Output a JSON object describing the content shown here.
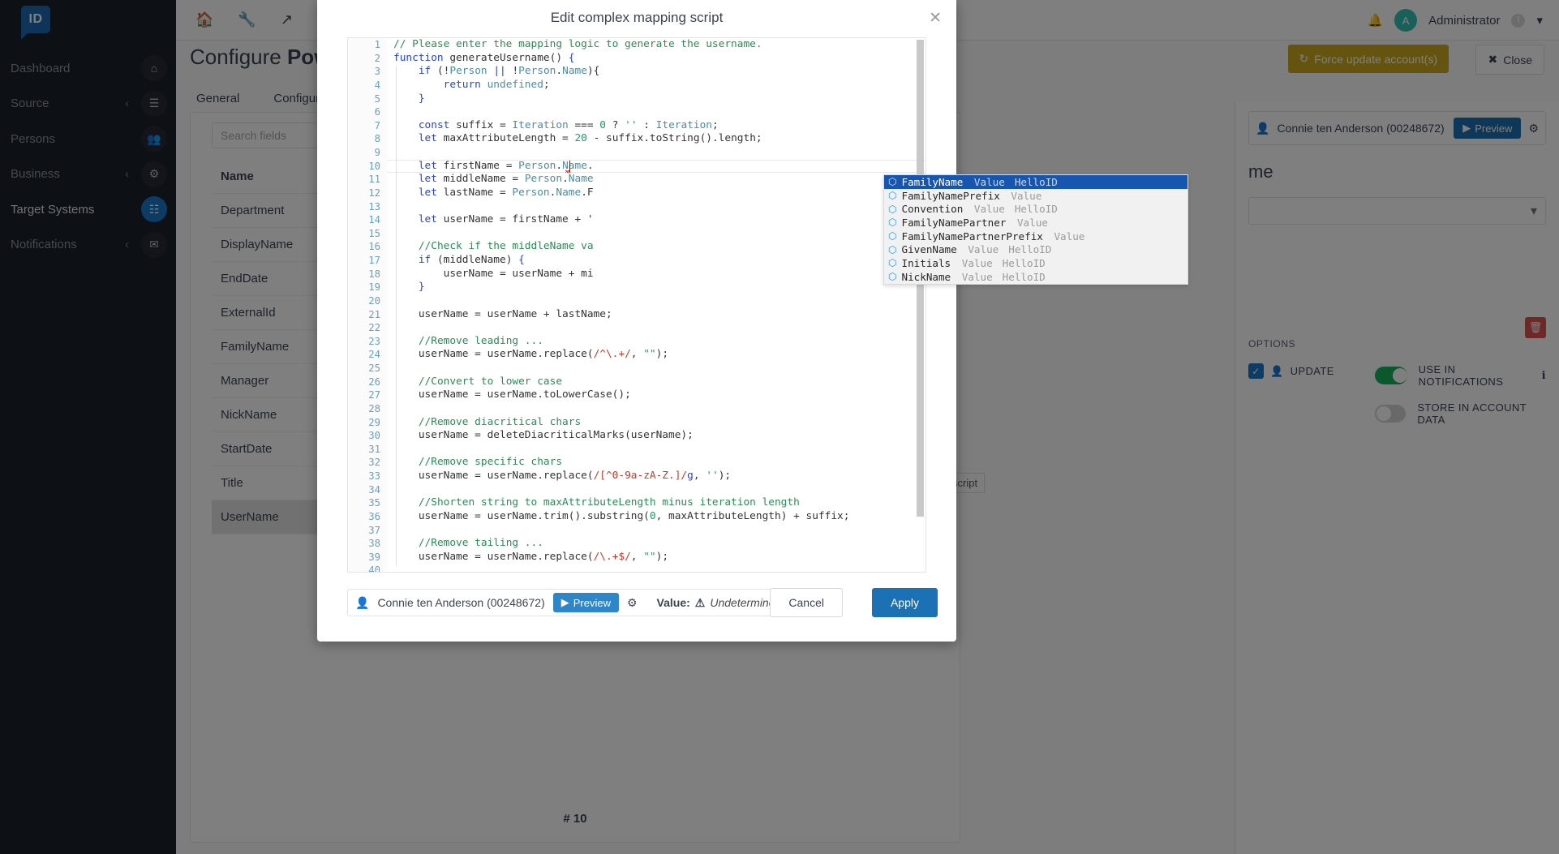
{
  "app": {
    "logo_text": "ID",
    "sidebar": {
      "items": [
        {
          "label": "Dashboard",
          "icon": "home-icon",
          "chevron": false,
          "active": false
        },
        {
          "label": "Source",
          "icon": "layers-icon",
          "chevron": true,
          "active": false
        },
        {
          "label": "Persons",
          "icon": "people-icon",
          "chevron": false,
          "active": false
        },
        {
          "label": "Business",
          "icon": "gear-circle-icon",
          "chevron": true,
          "active": false
        },
        {
          "label": "Target Systems",
          "icon": "grid-icon",
          "chevron": false,
          "active": true
        },
        {
          "label": "Notifications",
          "icon": "mail-icon",
          "chevron": true,
          "active": false
        }
      ]
    },
    "topbar": {
      "icons": [
        "home-icon",
        "wrench-icon",
        "connector-icon",
        "chart-icon",
        "help-icon"
      ],
      "bell": "bell-icon",
      "user_initial": "A",
      "user_name": "Administrator",
      "warning_badge": "!",
      "caret": "▾"
    },
    "page": {
      "title_prefix": "Configure ",
      "title_bold": "PowerSh",
      "force_update_label": "Force update account(s)",
      "force_update_icon": "refresh-icon",
      "close_label": "Close",
      "close_icon": "x-icon",
      "tabs": [
        "General",
        "Configuration"
      ],
      "search_placeholder": "Search fields",
      "table": {
        "header": "Name",
        "rows": [
          "Department",
          "DisplayName",
          "EndDate",
          "ExternalId",
          "FamilyName",
          "Manager",
          "NickName",
          "StartDate",
          "Title",
          "UserName"
        ],
        "selected": "UserName"
      },
      "pager": "# 10",
      "script_tag": "script"
    },
    "right_panel": {
      "person_label": "Connie ten Anderson (00248672)",
      "person_icon": "person-add-icon",
      "preview_label": "Preview",
      "preview_icon": "play-icon",
      "gear_icon": "gear-icon",
      "field_title": "me",
      "options_header": "OPTIONS",
      "update_label": "UPDATE",
      "update_icon": "person-sync-icon",
      "delete_icon": "trash-icon",
      "toggles": [
        {
          "label": "USE IN NOTIFICATIONS",
          "on": true,
          "info": "ℹ"
        },
        {
          "label": "STORE IN ACCOUNT DATA",
          "on": false,
          "info": ""
        }
      ]
    }
  },
  "modal": {
    "title": "Edit complex mapping script",
    "close_icon": "close-icon",
    "cancel_label": "Cancel",
    "apply_label": "Apply",
    "footer": {
      "person_label": "Connie ten Anderson (00248672)",
      "person_icon": "person-add-icon",
      "preview_label": "Preview",
      "preview_icon": "play-icon",
      "gear_icon": "gear-icon",
      "value_label": "Value:",
      "value_warn_icon": "warning-icon",
      "value_text": "Undetermined"
    },
    "editor": {
      "cursor_line": 10,
      "lines": [
        {
          "n": 1,
          "tokens": [
            {
              "t": "// Please enter the mapping logic to generate the username.",
              "c": "tok-com"
            }
          ]
        },
        {
          "n": 2,
          "tokens": [
            {
              "t": "function",
              "c": "tok-kw"
            },
            {
              "t": " generateUsername",
              "c": "tok-fn"
            },
            {
              "t": "() ",
              "c": "tok-str"
            },
            {
              "t": "{",
              "c": "tok-g"
            }
          ]
        },
        {
          "n": 3,
          "tokens": [
            {
              "t": "    ",
              "c": ""
            },
            {
              "t": "if",
              "c": "tok-kw"
            },
            {
              "t": " (!",
              "c": "tok-str"
            },
            {
              "t": "Person",
              "c": "tok-id"
            },
            {
              "t": " || ",
              "c": "tok-g"
            },
            {
              "t": "!",
              "c": "tok-str"
            },
            {
              "t": "Person",
              "c": "tok-id"
            },
            {
              "t": ".",
              "c": "tok-str"
            },
            {
              "t": "Name",
              "c": "tok-id"
            },
            {
              "t": "){",
              "c": "tok-str"
            }
          ]
        },
        {
          "n": 4,
          "tokens": [
            {
              "t": "        ",
              "c": ""
            },
            {
              "t": "return",
              "c": "tok-ret"
            },
            {
              "t": " undefined",
              "c": "tok-id"
            },
            {
              "t": ";",
              "c": "tok-str"
            }
          ]
        },
        {
          "n": 5,
          "tokens": [
            {
              "t": "    ",
              "c": ""
            },
            {
              "t": "}",
              "c": "tok-g"
            }
          ]
        },
        {
          "n": 6,
          "tokens": []
        },
        {
          "n": 7,
          "tokens": [
            {
              "t": "    ",
              "c": ""
            },
            {
              "t": "const",
              "c": "tok-kw"
            },
            {
              "t": " suffix = ",
              "c": "tok-str"
            },
            {
              "t": "Iteration",
              "c": "tok-id"
            },
            {
              "t": " === ",
              "c": "tok-str"
            },
            {
              "t": "0",
              "c": "tok-num"
            },
            {
              "t": " ? ",
              "c": "tok-str"
            },
            {
              "t": "''",
              "c": "tok-num"
            },
            {
              "t": " : ",
              "c": "tok-str"
            },
            {
              "t": "Iteration",
              "c": "tok-id"
            },
            {
              "t": ";",
              "c": "tok-str"
            }
          ]
        },
        {
          "n": 8,
          "tokens": [
            {
              "t": "    ",
              "c": ""
            },
            {
              "t": "let",
              "c": "tok-kw"
            },
            {
              "t": " maxAttributeLength = ",
              "c": "tok-str"
            },
            {
              "t": "20",
              "c": "tok-num"
            },
            {
              "t": " - suffix.",
              "c": "tok-str"
            },
            {
              "t": "toString",
              "c": "tok-str"
            },
            {
              "t": "().length;",
              "c": "tok-str"
            }
          ]
        },
        {
          "n": 9,
          "tokens": []
        },
        {
          "n": 10,
          "tokens": [
            {
              "t": "    ",
              "c": ""
            },
            {
              "t": "let",
              "c": "tok-kw"
            },
            {
              "t": " firstName = ",
              "c": "tok-str"
            },
            {
              "t": "Person",
              "c": "tok-id"
            },
            {
              "t": ".",
              "c": "tok-str"
            },
            {
              "t": "Name",
              "c": "tok-id"
            },
            {
              "t": ".",
              "c": "tok-str"
            }
          ]
        },
        {
          "n": 11,
          "tokens": [
            {
              "t": "    ",
              "c": ""
            },
            {
              "t": "let",
              "c": "tok-kw"
            },
            {
              "t": " middleName = ",
              "c": "tok-str"
            },
            {
              "t": "Person",
              "c": "tok-id"
            },
            {
              "t": ".",
              "c": "tok-str"
            },
            {
              "t": "Name",
              "c": "tok-id"
            }
          ]
        },
        {
          "n": 12,
          "tokens": [
            {
              "t": "    ",
              "c": ""
            },
            {
              "t": "let",
              "c": "tok-kw"
            },
            {
              "t": " lastName = ",
              "c": "tok-str"
            },
            {
              "t": "Person",
              "c": "tok-id"
            },
            {
              "t": ".",
              "c": "tok-str"
            },
            {
              "t": "Name",
              "c": "tok-id"
            },
            {
              "t": ".F",
              "c": "tok-str"
            }
          ]
        },
        {
          "n": 13,
          "tokens": []
        },
        {
          "n": 14,
          "tokens": [
            {
              "t": "    ",
              "c": ""
            },
            {
              "t": "let",
              "c": "tok-kw"
            },
            {
              "t": " userName = firstName + '",
              "c": "tok-str"
            }
          ]
        },
        {
          "n": 15,
          "tokens": []
        },
        {
          "n": 16,
          "tokens": [
            {
              "t": "    ",
              "c": ""
            },
            {
              "t": "//Check if the middleName va",
              "c": "tok-com"
            }
          ]
        },
        {
          "n": 17,
          "tokens": [
            {
              "t": "    ",
              "c": ""
            },
            {
              "t": "if",
              "c": "tok-kw"
            },
            {
              "t": " (middleName) ",
              "c": "tok-str"
            },
            {
              "t": "{",
              "c": "tok-g"
            }
          ]
        },
        {
          "n": 18,
          "tokens": [
            {
              "t": "        ",
              "c": ""
            },
            {
              "t": "userName = userName + mi",
              "c": "tok-str"
            }
          ]
        },
        {
          "n": 19,
          "tokens": [
            {
              "t": "    ",
              "c": ""
            },
            {
              "t": "}",
              "c": "tok-g"
            }
          ]
        },
        {
          "n": 20,
          "tokens": []
        },
        {
          "n": 21,
          "tokens": [
            {
              "t": "    ",
              "c": ""
            },
            {
              "t": "userName = userName + lastName;",
              "c": "tok-str"
            }
          ]
        },
        {
          "n": 22,
          "tokens": []
        },
        {
          "n": 23,
          "tokens": [
            {
              "t": "    ",
              "c": ""
            },
            {
              "t": "//Remove leading ...",
              "c": "tok-com"
            }
          ]
        },
        {
          "n": 24,
          "tokens": [
            {
              "t": "    ",
              "c": ""
            },
            {
              "t": "userName = userName.replace(",
              "c": "tok-str"
            },
            {
              "t": "/^\\.+/",
              "c": "tok-reg"
            },
            {
              "t": ", ",
              "c": "tok-str"
            },
            {
              "t": "\"\"",
              "c": "tok-num"
            },
            {
              "t": ");",
              "c": "tok-str"
            }
          ]
        },
        {
          "n": 25,
          "tokens": []
        },
        {
          "n": 26,
          "tokens": [
            {
              "t": "    ",
              "c": ""
            },
            {
              "t": "//Convert to lower case",
              "c": "tok-com"
            }
          ]
        },
        {
          "n": 27,
          "tokens": [
            {
              "t": "    ",
              "c": ""
            },
            {
              "t": "userName = userName.toLowerCase();",
              "c": "tok-str"
            }
          ]
        },
        {
          "n": 28,
          "tokens": []
        },
        {
          "n": 29,
          "tokens": [
            {
              "t": "    ",
              "c": ""
            },
            {
              "t": "//Remove diacritical chars",
              "c": "tok-com"
            }
          ]
        },
        {
          "n": 30,
          "tokens": [
            {
              "t": "    ",
              "c": ""
            },
            {
              "t": "userName = deleteDiacriticalMarks(userName);",
              "c": "tok-str"
            }
          ]
        },
        {
          "n": 31,
          "tokens": []
        },
        {
          "n": 32,
          "tokens": [
            {
              "t": "    ",
              "c": ""
            },
            {
              "t": "//Remove specific chars",
              "c": "tok-com"
            }
          ]
        },
        {
          "n": 33,
          "tokens": [
            {
              "t": "    ",
              "c": ""
            },
            {
              "t": "userName = userName.replace(",
              "c": "tok-str"
            },
            {
              "t": "/[^0-9a-zA-Z.]/",
              "c": "tok-reg"
            },
            {
              "t": "g",
              "c": "tok-g"
            },
            {
              "t": ", ",
              "c": "tok-str"
            },
            {
              "t": "''",
              "c": "tok-num"
            },
            {
              "t": ");",
              "c": "tok-str"
            }
          ]
        },
        {
          "n": 34,
          "tokens": []
        },
        {
          "n": 35,
          "tokens": [
            {
              "t": "    ",
              "c": ""
            },
            {
              "t": "//Shorten string to maxAttributeLength minus iteration length",
              "c": "tok-com"
            }
          ]
        },
        {
          "n": 36,
          "tokens": [
            {
              "t": "    ",
              "c": ""
            },
            {
              "t": "userName = userName.trim().substring(",
              "c": "tok-str"
            },
            {
              "t": "0",
              "c": "tok-num"
            },
            {
              "t": ", maxAttributeLength) + suffix;",
              "c": "tok-str"
            }
          ]
        },
        {
          "n": 37,
          "tokens": []
        },
        {
          "n": 38,
          "tokens": [
            {
              "t": "    ",
              "c": ""
            },
            {
              "t": "//Remove tailing ...",
              "c": "tok-com"
            }
          ]
        },
        {
          "n": 39,
          "tokens": [
            {
              "t": "    ",
              "c": ""
            },
            {
              "t": "userName = userName.replace(",
              "c": "tok-str"
            },
            {
              "t": "/\\.+$/",
              "c": "tok-reg"
            },
            {
              "t": ", ",
              "c": "tok-str"
            },
            {
              "t": "\"\"",
              "c": "tok-num"
            },
            {
              "t": ");",
              "c": "tok-str"
            }
          ]
        },
        {
          "n": 40,
          "tokens": []
        }
      ]
    },
    "autocomplete": {
      "icon": "cube-icon",
      "kind": "Value",
      "items": [
        {
          "name": "FamilyName",
          "kind": "Value",
          "source": "HelloID",
          "selected": true
        },
        {
          "name": "FamilyNamePrefix",
          "kind": "Value",
          "source": "",
          "selected": false
        },
        {
          "name": "Convention",
          "kind": "Value",
          "source": "HelloID",
          "selected": false
        },
        {
          "name": "FamilyNamePartner",
          "kind": "Value",
          "source": "",
          "selected": false
        },
        {
          "name": "FamilyNamePartnerPrefix",
          "kind": "Value",
          "source": "",
          "selected": false
        },
        {
          "name": "GivenName",
          "kind": "Value",
          "source": "HelloID",
          "selected": false
        },
        {
          "name": "Initials",
          "kind": "Value",
          "source": "HelloID",
          "selected": false
        },
        {
          "name": "NickName",
          "kind": "Value",
          "source": "HelloID",
          "selected": false
        }
      ]
    }
  },
  "colors": {
    "accent_blue": "#1c71b4",
    "sidebar_dark": "#1b2029",
    "gold": "#c8a820",
    "green_toggle": "#19b15a",
    "ac_selected": "#1756b0",
    "danger_red": "#d9534f"
  }
}
